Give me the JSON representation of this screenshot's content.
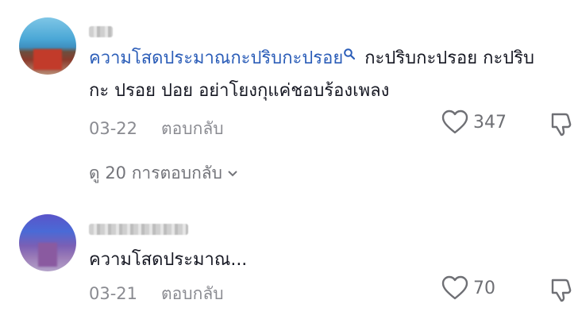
{
  "comments": [
    {
      "text_line1_link": "ความโสดประมาณกะปริบกะปรอย",
      "text_line1_rest": "กะปริบกะปรอย กะปริบ",
      "text_line2": "กะ ปรอย ปอย อย่าโยงกุแค่ชอบร้องเพลง",
      "date": "03-22",
      "reply_label": "ตอบกลับ",
      "like_count": "347",
      "view_replies": "ดู 20 การตอบกลับ"
    },
    {
      "text_line1": "ความโสดประมาณ...",
      "date": "03-21",
      "reply_label": "ตอบกลับ",
      "like_count": "70"
    }
  ]
}
